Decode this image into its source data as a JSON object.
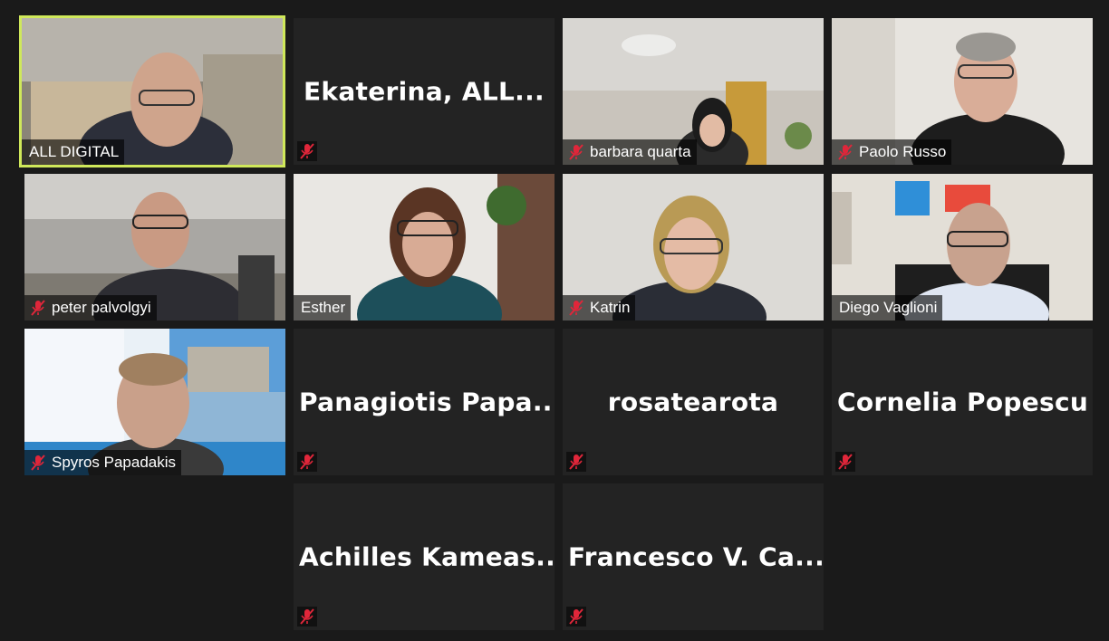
{
  "participants": [
    {
      "name": "ALL DIGITAL",
      "muted": false,
      "video": true,
      "active_speaker": true
    },
    {
      "name": "Ekaterina,  ALL...",
      "muted": true,
      "video": false
    },
    {
      "name": "barbara quarta",
      "muted": true,
      "video": true
    },
    {
      "name": "Paolo Russo",
      "muted": true,
      "video": true
    },
    {
      "name": "peter palvolgyi",
      "muted": true,
      "video": true
    },
    {
      "name": "Esther",
      "muted": false,
      "video": true
    },
    {
      "name": "Katrin",
      "muted": true,
      "video": true
    },
    {
      "name": "Diego Vaglioni",
      "muted": false,
      "video": true
    },
    {
      "name": "Spyros Papadakis",
      "muted": true,
      "video": true
    },
    {
      "name": "Panagiotis  Papa...",
      "muted": true,
      "video": false
    },
    {
      "name": "rosatearota",
      "muted": true,
      "video": false
    },
    {
      "name": "Cornelia Popescu",
      "muted": true,
      "video": false
    },
    {
      "name": "Achilles  Kameas...",
      "muted": true,
      "video": false
    },
    {
      "name": "Francesco  V.  Ca...",
      "muted": true,
      "video": false
    }
  ],
  "colors": {
    "background": "#1a1a1a",
    "tile": "#232323",
    "active_border": "#cfe85a",
    "mute_red": "#e0263a"
  },
  "icons": {
    "mute": "microphone-muted-icon"
  }
}
